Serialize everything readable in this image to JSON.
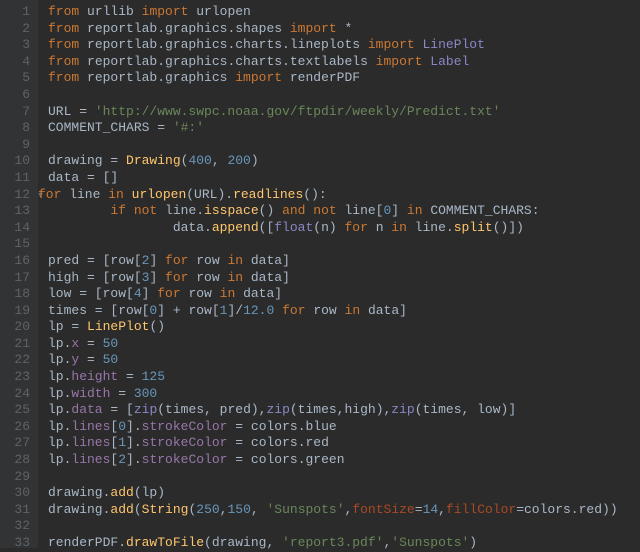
{
  "lines": [
    {
      "n": 1,
      "fold": "",
      "tokens": [
        {
          "c": "kw",
          "t": "from"
        },
        {
          "c": "ident",
          "t": " urllib "
        },
        {
          "c": "kw",
          "t": "import"
        },
        {
          "c": "ident",
          "t": " urlopen"
        }
      ]
    },
    {
      "n": 2,
      "fold": "",
      "tokens": [
        {
          "c": "kw",
          "t": "from"
        },
        {
          "c": "ident",
          "t": " reportlab.graphics.shapes "
        },
        {
          "c": "kw",
          "t": "import"
        },
        {
          "c": "ident",
          "t": " *"
        }
      ]
    },
    {
      "n": 3,
      "fold": "",
      "tokens": [
        {
          "c": "kw",
          "t": "from"
        },
        {
          "c": "ident",
          "t": " reportlab.graphics.charts.lineplots "
        },
        {
          "c": "kw",
          "t": "import"
        },
        {
          "c": "clsname",
          "t": " LinePlot"
        }
      ]
    },
    {
      "n": 4,
      "fold": "",
      "tokens": [
        {
          "c": "kw",
          "t": "from"
        },
        {
          "c": "ident",
          "t": " reportlab.graphics.charts.textlabels "
        },
        {
          "c": "kw",
          "t": "import"
        },
        {
          "c": "clsname",
          "t": " Label"
        }
      ]
    },
    {
      "n": 5,
      "fold": "",
      "tokens": [
        {
          "c": "kw",
          "t": "from"
        },
        {
          "c": "ident",
          "t": " reportlab.graphics "
        },
        {
          "c": "kw",
          "t": "import"
        },
        {
          "c": "ident",
          "t": " renderPDF"
        }
      ]
    },
    {
      "n": 6,
      "fold": "",
      "tokens": [
        {
          "c": "ident",
          "t": ""
        }
      ]
    },
    {
      "n": 7,
      "fold": "",
      "tokens": [
        {
          "c": "ident",
          "t": "URL = "
        },
        {
          "c": "str",
          "t": "'http://www.swpc.noaa.gov/ftpdir/weekly/Predict.txt'"
        }
      ]
    },
    {
      "n": 8,
      "fold": "",
      "tokens": [
        {
          "c": "ident",
          "t": "COMMENT_CHARS = "
        },
        {
          "c": "str",
          "t": "'#:'"
        }
      ]
    },
    {
      "n": 9,
      "fold": "",
      "tokens": [
        {
          "c": "ident",
          "t": ""
        }
      ]
    },
    {
      "n": 10,
      "fold": "",
      "tokens": [
        {
          "c": "ident",
          "t": "drawing = "
        },
        {
          "c": "call",
          "t": "Drawing"
        },
        {
          "c": "ident",
          "t": "("
        },
        {
          "c": "num",
          "t": "400"
        },
        {
          "c": "ident",
          "t": ", "
        },
        {
          "c": "num",
          "t": "200"
        },
        {
          "c": "ident",
          "t": ")"
        }
      ]
    },
    {
      "n": 11,
      "fold": "",
      "tokens": [
        {
          "c": "ident",
          "t": "data = []"
        }
      ]
    },
    {
      "n": 12,
      "fold": "▾",
      "tokens": [
        {
          "c": "kw",
          "t": "for"
        },
        {
          "c": "ident",
          "t": " line "
        },
        {
          "c": "kw",
          "t": "in"
        },
        {
          "c": "ident",
          "t": " "
        },
        {
          "c": "call",
          "t": "urlopen"
        },
        {
          "c": "ident",
          "t": "(URL)."
        },
        {
          "c": "call",
          "t": "readlines"
        },
        {
          "c": "ident",
          "t": "():"
        }
      ]
    },
    {
      "n": 13,
      "fold": "",
      "tokens": [
        {
          "c": "ident",
          "t": "        "
        },
        {
          "c": "kw",
          "t": "if not"
        },
        {
          "c": "ident",
          "t": " line."
        },
        {
          "c": "call",
          "t": "isspace"
        },
        {
          "c": "ident",
          "t": "() "
        },
        {
          "c": "kw",
          "t": "and not"
        },
        {
          "c": "ident",
          "t": " line["
        },
        {
          "c": "num",
          "t": "0"
        },
        {
          "c": "ident",
          "t": "] "
        },
        {
          "c": "kw",
          "t": "in"
        },
        {
          "c": "ident",
          "t": " COMMENT_CHARS:"
        }
      ]
    },
    {
      "n": 14,
      "fold": "",
      "tokens": [
        {
          "c": "ident",
          "t": "                data."
        },
        {
          "c": "call",
          "t": "append"
        },
        {
          "c": "ident",
          "t": "(["
        },
        {
          "c": "builtin",
          "t": "float"
        },
        {
          "c": "ident",
          "t": "(n) "
        },
        {
          "c": "kw",
          "t": "for"
        },
        {
          "c": "ident",
          "t": " n "
        },
        {
          "c": "kw",
          "t": "in"
        },
        {
          "c": "ident",
          "t": " line."
        },
        {
          "c": "call",
          "t": "split"
        },
        {
          "c": "ident",
          "t": "()])"
        }
      ]
    },
    {
      "n": 15,
      "fold": "",
      "tokens": [
        {
          "c": "ident",
          "t": ""
        }
      ]
    },
    {
      "n": 16,
      "fold": "",
      "tokens": [
        {
          "c": "ident",
          "t": "pred = [row["
        },
        {
          "c": "num",
          "t": "2"
        },
        {
          "c": "ident",
          "t": "] "
        },
        {
          "c": "kw",
          "t": "for"
        },
        {
          "c": "ident",
          "t": " row "
        },
        {
          "c": "kw",
          "t": "in"
        },
        {
          "c": "ident",
          "t": " data]"
        }
      ]
    },
    {
      "n": 17,
      "fold": "",
      "tokens": [
        {
          "c": "ident",
          "t": "high = [row["
        },
        {
          "c": "num",
          "t": "3"
        },
        {
          "c": "ident",
          "t": "] "
        },
        {
          "c": "kw",
          "t": "for"
        },
        {
          "c": "ident",
          "t": " row "
        },
        {
          "c": "kw",
          "t": "in"
        },
        {
          "c": "ident",
          "t": " data]"
        }
      ]
    },
    {
      "n": 18,
      "fold": "",
      "tokens": [
        {
          "c": "ident",
          "t": "low = [row["
        },
        {
          "c": "num",
          "t": "4"
        },
        {
          "c": "ident",
          "t": "] "
        },
        {
          "c": "kw",
          "t": "for"
        },
        {
          "c": "ident",
          "t": " row "
        },
        {
          "c": "kw",
          "t": "in"
        },
        {
          "c": "ident",
          "t": " data]"
        }
      ]
    },
    {
      "n": 19,
      "fold": "",
      "tokens": [
        {
          "c": "ident",
          "t": "times = [row["
        },
        {
          "c": "num",
          "t": "0"
        },
        {
          "c": "ident",
          "t": "] + row["
        },
        {
          "c": "num",
          "t": "1"
        },
        {
          "c": "ident",
          "t": "]/"
        },
        {
          "c": "num",
          "t": "12.0"
        },
        {
          "c": "ident",
          "t": " "
        },
        {
          "c": "kw",
          "t": "for"
        },
        {
          "c": "ident",
          "t": " row "
        },
        {
          "c": "kw",
          "t": "in"
        },
        {
          "c": "ident",
          "t": " data]"
        }
      ]
    },
    {
      "n": 20,
      "fold": "",
      "tokens": [
        {
          "c": "ident",
          "t": "lp = "
        },
        {
          "c": "call",
          "t": "LinePlot"
        },
        {
          "c": "ident",
          "t": "()"
        }
      ]
    },
    {
      "n": 21,
      "fold": "",
      "tokens": [
        {
          "c": "ident",
          "t": "lp."
        },
        {
          "c": "attr",
          "t": "x"
        },
        {
          "c": "ident",
          "t": " = "
        },
        {
          "c": "num",
          "t": "50"
        }
      ]
    },
    {
      "n": 22,
      "fold": "",
      "tokens": [
        {
          "c": "ident",
          "t": "lp."
        },
        {
          "c": "attr",
          "t": "y"
        },
        {
          "c": "ident",
          "t": " = "
        },
        {
          "c": "num",
          "t": "50"
        }
      ]
    },
    {
      "n": 23,
      "fold": "",
      "tokens": [
        {
          "c": "ident",
          "t": "lp."
        },
        {
          "c": "attr",
          "t": "height"
        },
        {
          "c": "ident",
          "t": " = "
        },
        {
          "c": "num",
          "t": "125"
        }
      ]
    },
    {
      "n": 24,
      "fold": "",
      "tokens": [
        {
          "c": "ident",
          "t": "lp."
        },
        {
          "c": "attr",
          "t": "width"
        },
        {
          "c": "ident",
          "t": " = "
        },
        {
          "c": "num",
          "t": "300"
        }
      ]
    },
    {
      "n": 25,
      "fold": "",
      "tokens": [
        {
          "c": "ident",
          "t": "lp."
        },
        {
          "c": "attr",
          "t": "data"
        },
        {
          "c": "ident",
          "t": " = ["
        },
        {
          "c": "builtin",
          "t": "zip"
        },
        {
          "c": "ident",
          "t": "(times, pred),"
        },
        {
          "c": "builtin",
          "t": "zip"
        },
        {
          "c": "ident",
          "t": "(times,high),"
        },
        {
          "c": "builtin",
          "t": "zip"
        },
        {
          "c": "ident",
          "t": "(times, low)]"
        }
      ]
    },
    {
      "n": 26,
      "fold": "",
      "tokens": [
        {
          "c": "ident",
          "t": "lp."
        },
        {
          "c": "attr",
          "t": "lines"
        },
        {
          "c": "ident",
          "t": "["
        },
        {
          "c": "num",
          "t": "0"
        },
        {
          "c": "ident",
          "t": "]."
        },
        {
          "c": "attr",
          "t": "strokeColor"
        },
        {
          "c": "ident",
          "t": " = colors.blue"
        }
      ]
    },
    {
      "n": 27,
      "fold": "",
      "tokens": [
        {
          "c": "ident",
          "t": "lp."
        },
        {
          "c": "attr",
          "t": "lines"
        },
        {
          "c": "ident",
          "t": "["
        },
        {
          "c": "num",
          "t": "1"
        },
        {
          "c": "ident",
          "t": "]."
        },
        {
          "c": "attr",
          "t": "strokeColor"
        },
        {
          "c": "ident",
          "t": " = colors.red"
        }
      ]
    },
    {
      "n": 28,
      "fold": "",
      "tokens": [
        {
          "c": "ident",
          "t": "lp."
        },
        {
          "c": "attr",
          "t": "lines"
        },
        {
          "c": "ident",
          "t": "["
        },
        {
          "c": "num",
          "t": "2"
        },
        {
          "c": "ident",
          "t": "]."
        },
        {
          "c": "attr",
          "t": "strokeColor"
        },
        {
          "c": "ident",
          "t": " = colors.green"
        }
      ]
    },
    {
      "n": 29,
      "fold": "",
      "tokens": [
        {
          "c": "ident",
          "t": ""
        }
      ]
    },
    {
      "n": 30,
      "fold": "",
      "tokens": [
        {
          "c": "ident",
          "t": "drawing."
        },
        {
          "c": "call",
          "t": "add"
        },
        {
          "c": "ident",
          "t": "(lp)"
        }
      ]
    },
    {
      "n": 31,
      "fold": "",
      "tokens": [
        {
          "c": "ident",
          "t": "drawing."
        },
        {
          "c": "call",
          "t": "add"
        },
        {
          "c": "ident",
          "t": "("
        },
        {
          "c": "call",
          "t": "String"
        },
        {
          "c": "ident",
          "t": "("
        },
        {
          "c": "num",
          "t": "250"
        },
        {
          "c": "ident",
          "t": ","
        },
        {
          "c": "num",
          "t": "150"
        },
        {
          "c": "ident",
          "t": ", "
        },
        {
          "c": "str",
          "t": "'Sunspots'"
        },
        {
          "c": "ident",
          "t": ","
        },
        {
          "c": "param",
          "t": "fontSize"
        },
        {
          "c": "ident",
          "t": "="
        },
        {
          "c": "num",
          "t": "14"
        },
        {
          "c": "ident",
          "t": ","
        },
        {
          "c": "param",
          "t": "fillColor"
        },
        {
          "c": "ident",
          "t": "=colors.red))"
        }
      ]
    },
    {
      "n": 32,
      "fold": "",
      "tokens": [
        {
          "c": "ident",
          "t": ""
        }
      ]
    },
    {
      "n": 33,
      "fold": "",
      "tokens": [
        {
          "c": "ident",
          "t": "renderPDF."
        },
        {
          "c": "call",
          "t": "drawToFile"
        },
        {
          "c": "ident",
          "t": "(drawing, "
        },
        {
          "c": "str",
          "t": "'report3.pdf'"
        },
        {
          "c": "ident",
          "t": ","
        },
        {
          "c": "str",
          "t": "'Sunspots'"
        },
        {
          "c": "ident",
          "t": ")"
        }
      ]
    }
  ]
}
